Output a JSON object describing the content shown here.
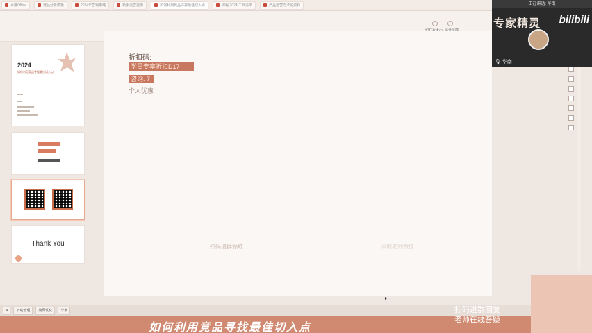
{
  "tabs": [
    {
      "label": "百度Office",
      "active": false
    },
    {
      "label": "竞品分析模板",
      "active": false
    },
    {
      "label": "2024年营销策略",
      "active": false
    },
    {
      "label": "新手运营指南",
      "active": false
    },
    {
      "label": "如何利用竞品寻找最佳切入点",
      "active": true
    },
    {
      "label": "课程 2024 工具清单",
      "active": false
    },
    {
      "label": "产品运营方法论资料",
      "active": false
    }
  ],
  "ribbon": {
    "buttons": [
      "幻灯片大小",
      "设计灵感"
    ]
  },
  "thumbnails": {
    "slide1": {
      "year": "2024",
      "subtitle": "如何利用竞品寻找最佳切入点"
    },
    "slide4": {
      "text": "Thank You"
    }
  },
  "slide": {
    "label": "折扣码:",
    "highlight1": "学员专享折扣D17",
    "highlight2": "咨询: 7",
    "note": "个人优惠",
    "caption1": "扫码进群领取",
    "caption2": "添加老师微信"
  },
  "webcam": {
    "status": "正在讲话: 华南",
    "title": "专家精灵",
    "logo": "bilibili",
    "speaker": "华南"
  },
  "taskbar": [
    "A",
    "下载管理",
    "简历优化",
    "华南"
  ],
  "banner": {
    "title": "如何利用竞品寻找最佳切入点"
  },
  "card": {
    "line1": "扫码进群回复",
    "line2": "老师在线答疑"
  },
  "colors": {
    "accent": "#c8785e",
    "banner": "#d18a72",
    "card": "#ecc5b4"
  }
}
